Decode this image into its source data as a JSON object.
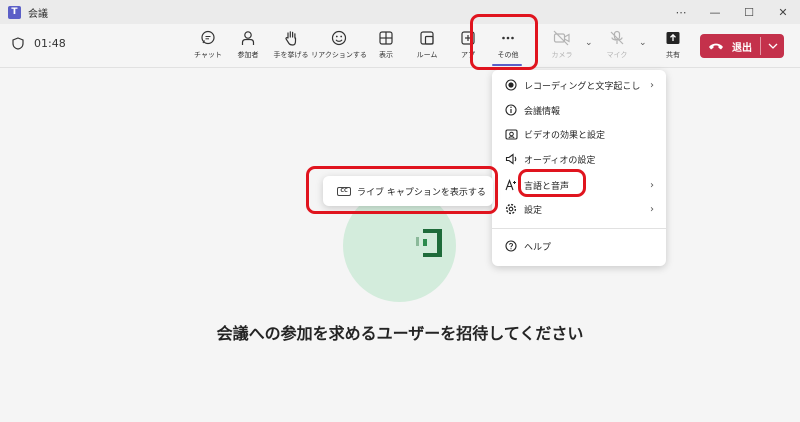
{
  "window": {
    "title": "会議",
    "app_icon_letter": "T",
    "controls": [
      "more-icon",
      "minimize-icon",
      "maximize-icon",
      "close-icon"
    ]
  },
  "toolbar": {
    "timer": "01:48",
    "buttons": [
      {
        "label": "チャット",
        "icon": "chat-icon"
      },
      {
        "label": "参加者",
        "icon": "people-icon"
      },
      {
        "label": "手を挙げる",
        "icon": "raise-hand-icon"
      },
      {
        "label": "リアクションする",
        "icon": "emoji-icon"
      },
      {
        "label": "表示",
        "icon": "grid-view-icon"
      },
      {
        "label": "ルーム",
        "icon": "rooms-icon"
      },
      {
        "label": "アプ",
        "icon": "apps-icon"
      },
      {
        "label": "その他",
        "icon": "more-icon"
      },
      {
        "label": "カメラ",
        "icon": "camera-off-icon"
      },
      {
        "label": "マイク",
        "icon": "mic-off-icon"
      },
      {
        "label": "共有",
        "icon": "share-icon"
      }
    ],
    "leave": {
      "label": "退出",
      "color": "#c4314b"
    }
  },
  "more_menu": {
    "items": [
      {
        "label": "レコーディングと文字起こし",
        "icon": "record-icon",
        "has_submenu": true
      },
      {
        "label": "会議情報",
        "icon": "info-icon",
        "has_submenu": false
      },
      {
        "label": "ビデオの効果と設定",
        "icon": "video-effects-icon",
        "has_submenu": false
      },
      {
        "label": "オーディオの設定",
        "icon": "speaker-icon",
        "has_submenu": false
      },
      {
        "label": "言語と音声",
        "icon": "language-icon",
        "has_submenu": true
      },
      {
        "label": "設定",
        "icon": "gear-icon",
        "has_submenu": true
      },
      {
        "label": "ヘルプ",
        "icon": "help-icon",
        "has_submenu": false
      }
    ]
  },
  "submenu": {
    "label": "ライブ キャプションを表示する",
    "icon": "closed-caption-icon",
    "icon_text": "CC"
  },
  "stage": {
    "invite_text": "会議への参加を求めるユーザーを招待してください"
  },
  "colors": {
    "accent": "#5b5fc7",
    "highlight": "#e0141e",
    "logo_green": "#1e6b3a",
    "avatar_bg": "#d3ecdc"
  }
}
